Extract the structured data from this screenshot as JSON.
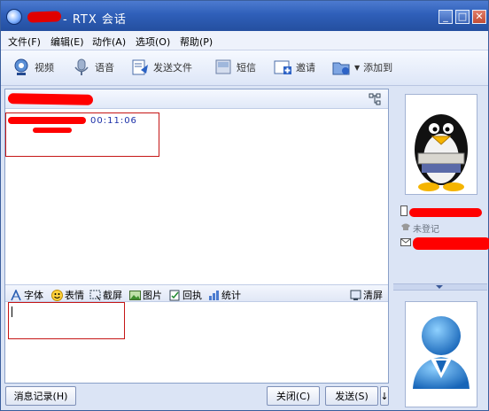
{
  "window": {
    "title": "- RTX 会话",
    "min": "_",
    "max": "□",
    "close": "✕"
  },
  "menu": [
    {
      "label": "文件(F)"
    },
    {
      "label": "编辑(E)"
    },
    {
      "label": "动作(A)"
    },
    {
      "label": "选项(O)"
    },
    {
      "label": "帮助(P)"
    }
  ],
  "toolbar": {
    "video": "视频",
    "voice": "语音",
    "send_file": "发送文件",
    "sms": "短信",
    "invite": "邀请",
    "add_to": "添加到"
  },
  "conversation": {
    "message_time": "00:11:06"
  },
  "format_bar": {
    "font": "字体",
    "emoji": "表情",
    "screenshot": "截屏",
    "picture": "图片",
    "receipt": "回执",
    "stats": "统计",
    "clear": "清屏"
  },
  "buttons": {
    "history": "消息记录(H)",
    "close": "关闭(C)",
    "send": "发送(S)",
    "send_options": "↓"
  },
  "contact_info": {
    "phone_status": "未登记"
  },
  "colors": {
    "accent": "#2f5fb9",
    "redaction": "#ff0000"
  }
}
